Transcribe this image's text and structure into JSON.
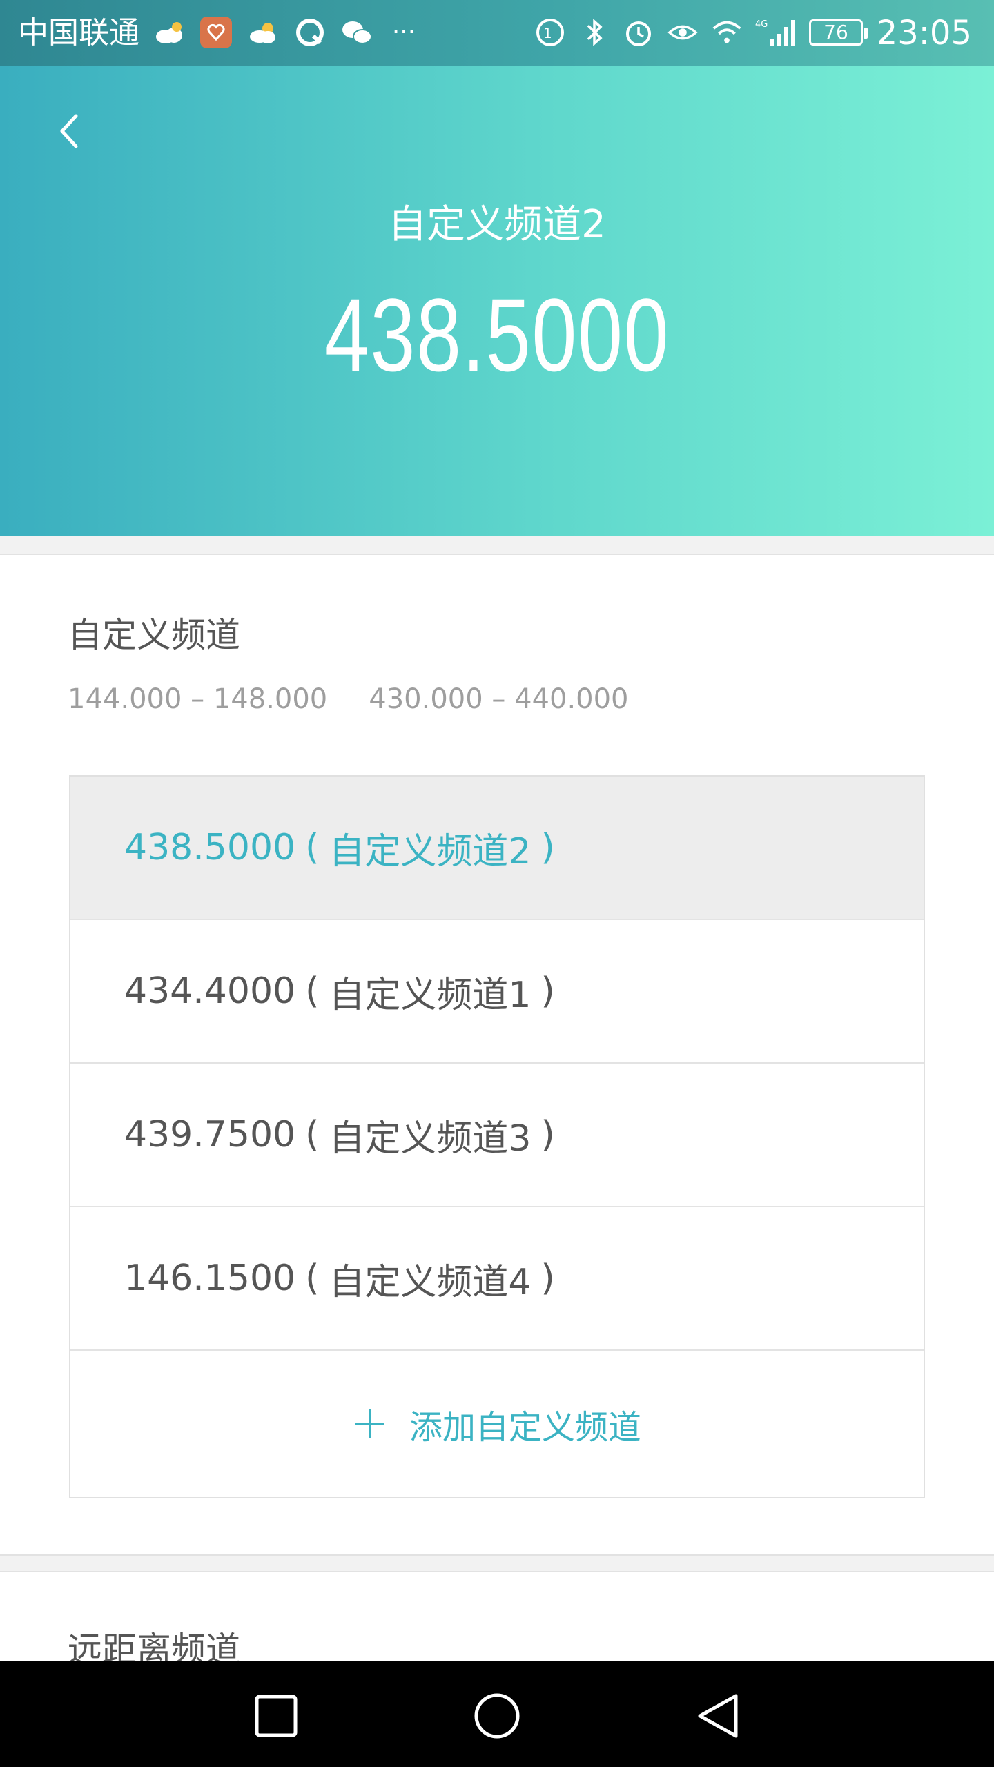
{
  "status_bar": {
    "carrier": "中国联通",
    "more": "···",
    "battery": "76",
    "network": "4G",
    "time": "23:05"
  },
  "header": {
    "title": "自定义频道2",
    "frequency": "438.5000"
  },
  "custom_section": {
    "title": "自定义频道",
    "ranges": [
      "144.000 – 148.000",
      "430.000 – 440.000"
    ]
  },
  "channels": [
    {
      "freq": "438.5000",
      "open": "(",
      "name": "自定义频道2",
      "close": ")",
      "selected": true
    },
    {
      "freq": "434.4000",
      "open": "(",
      "name": "自定义频道1",
      "close": ")",
      "selected": false
    },
    {
      "freq": "439.7500",
      "open": "(",
      "name": "自定义频道3",
      "close": ")",
      "selected": false
    },
    {
      "freq": "146.1500",
      "open": "(",
      "name": "自定义频道4",
      "close": ")",
      "selected": false
    }
  ],
  "add_button": {
    "label": "添加自定义频道"
  },
  "next_section": {
    "title": "远距离频道"
  },
  "colors": {
    "accent": "#3bb3c3",
    "header_gradient_start": "#3aaebf",
    "header_gradient_end": "#7bf0d6",
    "selected_row_bg": "#ededed"
  }
}
